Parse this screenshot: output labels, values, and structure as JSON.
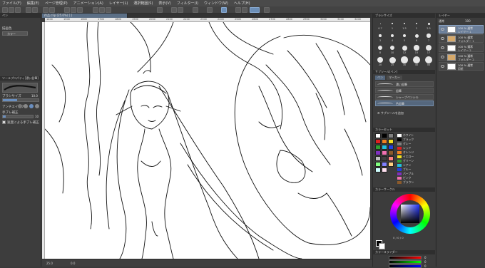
{
  "menu": [
    "ファイル(F)",
    "編集(E)",
    "ページ管理(P)",
    "アニメーション(A)",
    "レイヤー(L)",
    "選択範囲(S)",
    "表示(V)",
    "フィルター(I)",
    "ウィンドウ(W)",
    "ヘルプ(H)"
  ],
  "tool_property": {
    "header_top": "ペン",
    "label_color": "描画色",
    "dropdown_value": "カラー",
    "title": "ツールプロパティ[濃い鉛筆]",
    "brush_size_label": "ブラシサイズ",
    "brush_size_value": "10.0",
    "antialias_label": "アンチエイリアス",
    "stabilizer_label": "手ブレ補正",
    "stabilizer_value": "10",
    "speed_check_label": "速度による手ブレ補正"
  },
  "document_tab": "作品.clip (25.0%) [ ]",
  "ruler_ticks": [
    "1400",
    "1500",
    "1600",
    "1700",
    "1800",
    "1900",
    "2000",
    "2100",
    "2200",
    "2300",
    "2400",
    "2500",
    "2600",
    "2700",
    "2800",
    "2900",
    "3000",
    "3100",
    "3200"
  ],
  "status": {
    "zoom": "25.0",
    "angle": "0.0"
  },
  "brush_size_panel": {
    "title": "ブラシサイズ",
    "sizes": [
      "0.7",
      "1",
      "1.5",
      "2",
      "2.5",
      "3",
      "4",
      "5",
      "6",
      "7",
      "8",
      "10",
      "12",
      "15",
      "17",
      "20",
      "25",
      "30",
      "40",
      "50"
    ]
  },
  "sub_tool_panel": {
    "title": "サブツール[ペン]",
    "tabs": [
      "ペン",
      "マーカー"
    ],
    "items": [
      "濃い鉛筆",
      "鉛筆",
      "シャープペンシル",
      "色鉛筆"
    ],
    "add_label": "サブツールを追加"
  },
  "color_set_panel": {
    "title": "カラーセット",
    "items": [
      "ホワイト",
      "ブラック",
      "グレー",
      "レッド",
      "オレンジ",
      "イエロー",
      "グリーン",
      "シアン",
      "ブルー",
      "パープル",
      "ピンク",
      "ブラウン"
    ]
  },
  "color_wheel_panel": {
    "title": "カラーサークル",
    "h": "0",
    "s": "0",
    "v": "0"
  },
  "color_slider_panel": {
    "title": "カラースライダー",
    "values": [
      "0",
      "0",
      "0"
    ]
  },
  "layer_panel": {
    "title": "レイヤー",
    "blend": "通常",
    "opacity": "100",
    "layers": [
      {
        "name": "100 % 通常",
        "sub": "レイヤー 1"
      },
      {
        "name": "100 % 通常",
        "sub": "フォルダー 1"
      },
      {
        "name": "100 % 通常",
        "sub": "レイヤー 2"
      },
      {
        "name": "100 % 通常",
        "sub": "フォルダー 2"
      },
      {
        "name": "100 % 通常",
        "sub": "用紙"
      }
    ]
  },
  "colors": {
    "accent": "#6a8fc0",
    "selected_layer": "#6b7e99",
    "swatches": [
      "#ffffff",
      "#000000",
      "#808080",
      "#e02020",
      "#f08020",
      "#f0e020",
      "#30a030",
      "#20c0e0",
      "#2040e0",
      "#8030c0",
      "#f070b0",
      "#8b5a2b",
      "#c0c0c0",
      "#404040",
      "#ff8080",
      "#80ff80",
      "#8080ff",
      "#ffd080",
      "#d0ffff",
      "#ffe0f0"
    ]
  }
}
